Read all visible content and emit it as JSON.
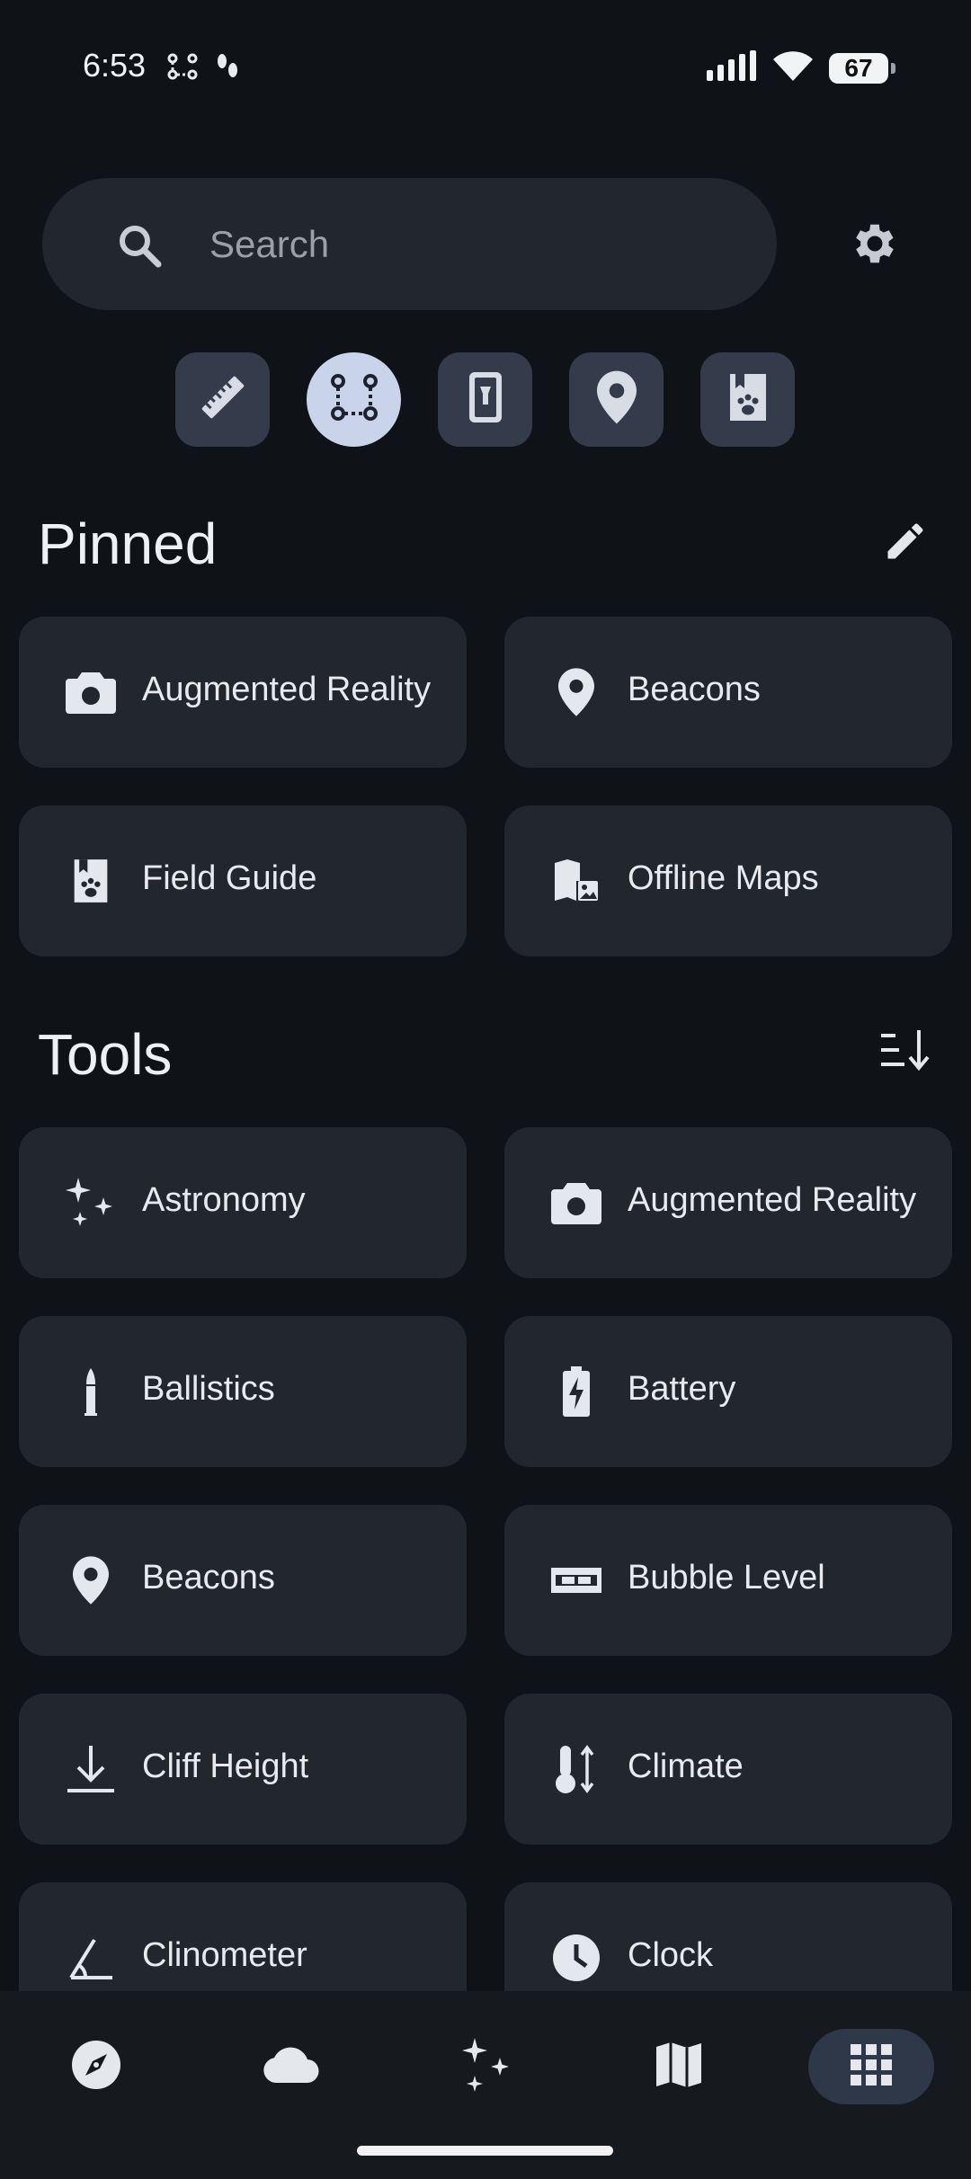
{
  "status": {
    "time": "6:53",
    "battery": "67"
  },
  "search": {
    "placeholder": "Search"
  },
  "quick": [
    "ruler-icon",
    "path-icon",
    "flashlight-icon",
    "location-pin-icon",
    "field-guide-icon"
  ],
  "pinned": {
    "title": "Pinned",
    "items": [
      {
        "label": "Augmented Reality",
        "icon": "camera-icon"
      },
      {
        "label": "Beacons",
        "icon": "location-pin-icon"
      },
      {
        "label": "Field Guide",
        "icon": "field-guide-icon"
      },
      {
        "label": "Offline Maps",
        "icon": "offline-maps-icon"
      }
    ]
  },
  "tools": {
    "title": "Tools",
    "items": [
      {
        "label": "Astronomy",
        "icon": "sparkle-icon"
      },
      {
        "label": "Augmented Reality",
        "icon": "camera-icon"
      },
      {
        "label": "Ballistics",
        "icon": "bullet-icon"
      },
      {
        "label": "Battery",
        "icon": "battery-charging-icon"
      },
      {
        "label": "Beacons",
        "icon": "location-pin-icon"
      },
      {
        "label": "Bubble Level",
        "icon": "bubble-level-icon"
      },
      {
        "label": "Cliff Height",
        "icon": "cliff-height-icon"
      },
      {
        "label": "Climate",
        "icon": "thermometer-icon"
      },
      {
        "label": "Clinometer",
        "icon": "angle-icon"
      },
      {
        "label": "Clock",
        "icon": "clock-icon"
      }
    ]
  },
  "bottom_nav": [
    "navigation-icon",
    "weather-cloud-icon",
    "astronomy-icon",
    "map-icon",
    "tools-grid-icon"
  ],
  "colors": {
    "background": "#0f1217",
    "tile": "#22262d",
    "active_chip": "#c9d4ea",
    "nav_active": "#2f3848"
  }
}
